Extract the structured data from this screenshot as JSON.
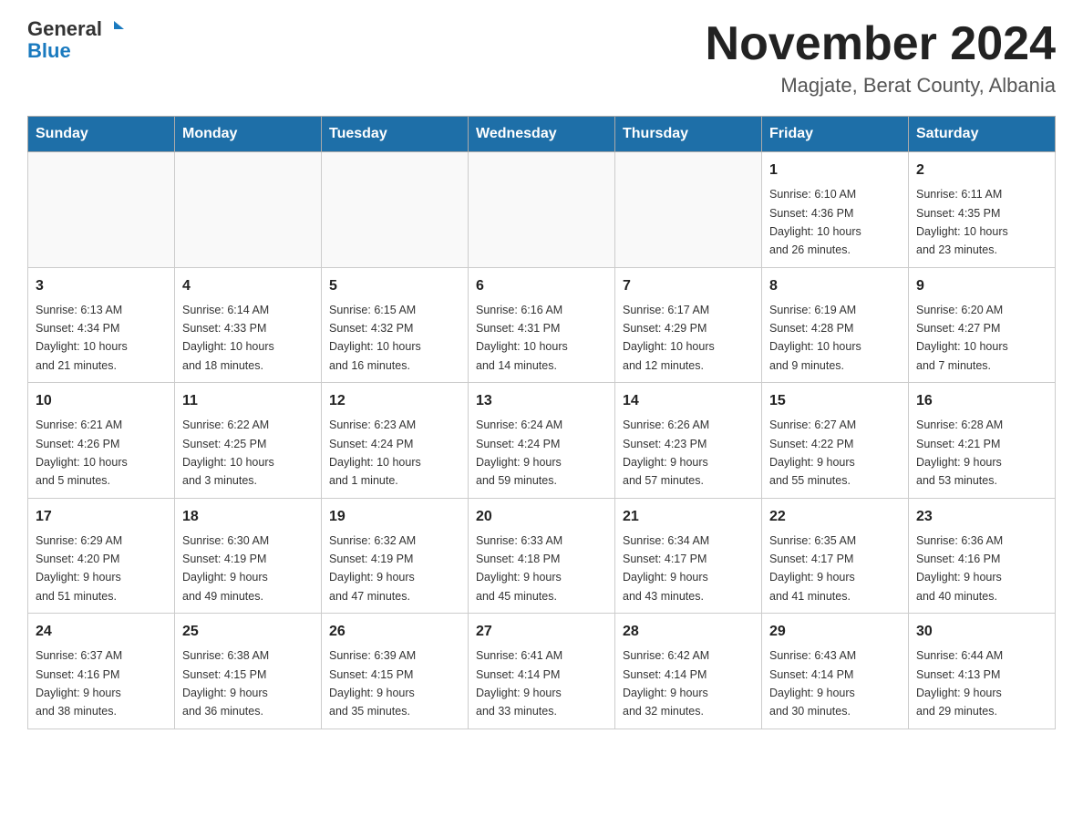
{
  "header": {
    "logo_general": "General",
    "logo_blue": "Blue",
    "title": "November 2024",
    "subtitle": "Magjate, Berat County, Albania"
  },
  "weekdays": [
    "Sunday",
    "Monday",
    "Tuesday",
    "Wednesday",
    "Thursday",
    "Friday",
    "Saturday"
  ],
  "weeks": [
    [
      {
        "day": "",
        "info": ""
      },
      {
        "day": "",
        "info": ""
      },
      {
        "day": "",
        "info": ""
      },
      {
        "day": "",
        "info": ""
      },
      {
        "day": "",
        "info": ""
      },
      {
        "day": "1",
        "info": "Sunrise: 6:10 AM\nSunset: 4:36 PM\nDaylight: 10 hours\nand 26 minutes."
      },
      {
        "day": "2",
        "info": "Sunrise: 6:11 AM\nSunset: 4:35 PM\nDaylight: 10 hours\nand 23 minutes."
      }
    ],
    [
      {
        "day": "3",
        "info": "Sunrise: 6:13 AM\nSunset: 4:34 PM\nDaylight: 10 hours\nand 21 minutes."
      },
      {
        "day": "4",
        "info": "Sunrise: 6:14 AM\nSunset: 4:33 PM\nDaylight: 10 hours\nand 18 minutes."
      },
      {
        "day": "5",
        "info": "Sunrise: 6:15 AM\nSunset: 4:32 PM\nDaylight: 10 hours\nand 16 minutes."
      },
      {
        "day": "6",
        "info": "Sunrise: 6:16 AM\nSunset: 4:31 PM\nDaylight: 10 hours\nand 14 minutes."
      },
      {
        "day": "7",
        "info": "Sunrise: 6:17 AM\nSunset: 4:29 PM\nDaylight: 10 hours\nand 12 minutes."
      },
      {
        "day": "8",
        "info": "Sunrise: 6:19 AM\nSunset: 4:28 PM\nDaylight: 10 hours\nand 9 minutes."
      },
      {
        "day": "9",
        "info": "Sunrise: 6:20 AM\nSunset: 4:27 PM\nDaylight: 10 hours\nand 7 minutes."
      }
    ],
    [
      {
        "day": "10",
        "info": "Sunrise: 6:21 AM\nSunset: 4:26 PM\nDaylight: 10 hours\nand 5 minutes."
      },
      {
        "day": "11",
        "info": "Sunrise: 6:22 AM\nSunset: 4:25 PM\nDaylight: 10 hours\nand 3 minutes."
      },
      {
        "day": "12",
        "info": "Sunrise: 6:23 AM\nSunset: 4:24 PM\nDaylight: 10 hours\nand 1 minute."
      },
      {
        "day": "13",
        "info": "Sunrise: 6:24 AM\nSunset: 4:24 PM\nDaylight: 9 hours\nand 59 minutes."
      },
      {
        "day": "14",
        "info": "Sunrise: 6:26 AM\nSunset: 4:23 PM\nDaylight: 9 hours\nand 57 minutes."
      },
      {
        "day": "15",
        "info": "Sunrise: 6:27 AM\nSunset: 4:22 PM\nDaylight: 9 hours\nand 55 minutes."
      },
      {
        "day": "16",
        "info": "Sunrise: 6:28 AM\nSunset: 4:21 PM\nDaylight: 9 hours\nand 53 minutes."
      }
    ],
    [
      {
        "day": "17",
        "info": "Sunrise: 6:29 AM\nSunset: 4:20 PM\nDaylight: 9 hours\nand 51 minutes."
      },
      {
        "day": "18",
        "info": "Sunrise: 6:30 AM\nSunset: 4:19 PM\nDaylight: 9 hours\nand 49 minutes."
      },
      {
        "day": "19",
        "info": "Sunrise: 6:32 AM\nSunset: 4:19 PM\nDaylight: 9 hours\nand 47 minutes."
      },
      {
        "day": "20",
        "info": "Sunrise: 6:33 AM\nSunset: 4:18 PM\nDaylight: 9 hours\nand 45 minutes."
      },
      {
        "day": "21",
        "info": "Sunrise: 6:34 AM\nSunset: 4:17 PM\nDaylight: 9 hours\nand 43 minutes."
      },
      {
        "day": "22",
        "info": "Sunrise: 6:35 AM\nSunset: 4:17 PM\nDaylight: 9 hours\nand 41 minutes."
      },
      {
        "day": "23",
        "info": "Sunrise: 6:36 AM\nSunset: 4:16 PM\nDaylight: 9 hours\nand 40 minutes."
      }
    ],
    [
      {
        "day": "24",
        "info": "Sunrise: 6:37 AM\nSunset: 4:16 PM\nDaylight: 9 hours\nand 38 minutes."
      },
      {
        "day": "25",
        "info": "Sunrise: 6:38 AM\nSunset: 4:15 PM\nDaylight: 9 hours\nand 36 minutes."
      },
      {
        "day": "26",
        "info": "Sunrise: 6:39 AM\nSunset: 4:15 PM\nDaylight: 9 hours\nand 35 minutes."
      },
      {
        "day": "27",
        "info": "Sunrise: 6:41 AM\nSunset: 4:14 PM\nDaylight: 9 hours\nand 33 minutes."
      },
      {
        "day": "28",
        "info": "Sunrise: 6:42 AM\nSunset: 4:14 PM\nDaylight: 9 hours\nand 32 minutes."
      },
      {
        "day": "29",
        "info": "Sunrise: 6:43 AM\nSunset: 4:14 PM\nDaylight: 9 hours\nand 30 minutes."
      },
      {
        "day": "30",
        "info": "Sunrise: 6:44 AM\nSunset: 4:13 PM\nDaylight: 9 hours\nand 29 minutes."
      }
    ]
  ]
}
